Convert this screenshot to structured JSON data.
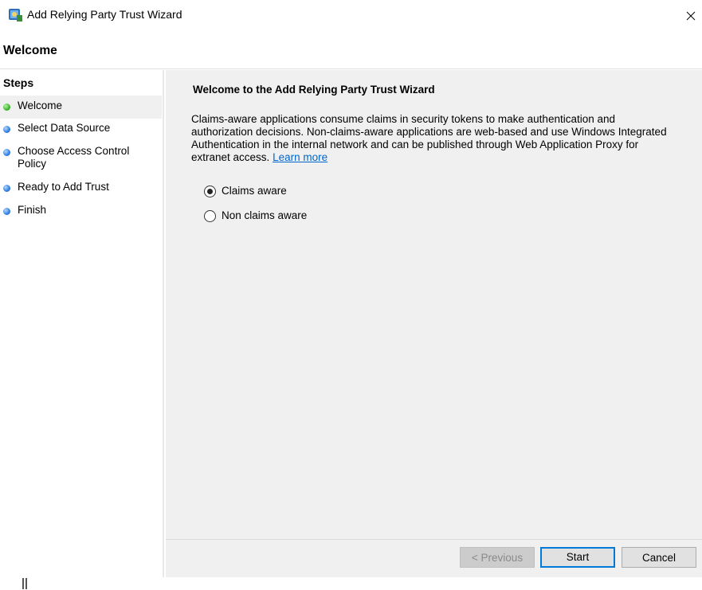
{
  "window": {
    "title": "Add Relying Party Trust Wizard"
  },
  "header": {
    "title": "Welcome"
  },
  "steps": {
    "title": "Steps",
    "items": [
      {
        "label": "Welcome",
        "status": "current"
      },
      {
        "label": "Select Data Source",
        "status": "pending"
      },
      {
        "label": "Choose Access Control Policy",
        "status": "pending"
      },
      {
        "label": "Ready to Add Trust",
        "status": "pending"
      },
      {
        "label": "Finish",
        "status": "pending"
      }
    ]
  },
  "content": {
    "title": "Welcome to the Add Relying Party Trust Wizard",
    "description": "Claims-aware applications consume claims in security tokens to make authentication and authorization decisions. Non-claims-aware applications are web-based and use Windows Integrated Authentication in the internal network and can be published through Web Application Proxy for extranet access.",
    "learn_more": "Learn more",
    "options": [
      {
        "label": "Claims aware",
        "selected": true
      },
      {
        "label": "Non claims aware",
        "selected": false
      }
    ]
  },
  "buttons": {
    "previous": "< Previous",
    "start": "Start",
    "cancel": "Cancel"
  },
  "colors": {
    "step_current": "#3bb52a",
    "step_pending": "#2f7fe0",
    "link": "#0066cc",
    "default_button_border": "#0078d7"
  },
  "icons": {
    "app": "relying-party-trust-icon",
    "close": "close-icon",
    "current_step": "green-dot-icon",
    "pending_step": "blue-dot-icon"
  }
}
